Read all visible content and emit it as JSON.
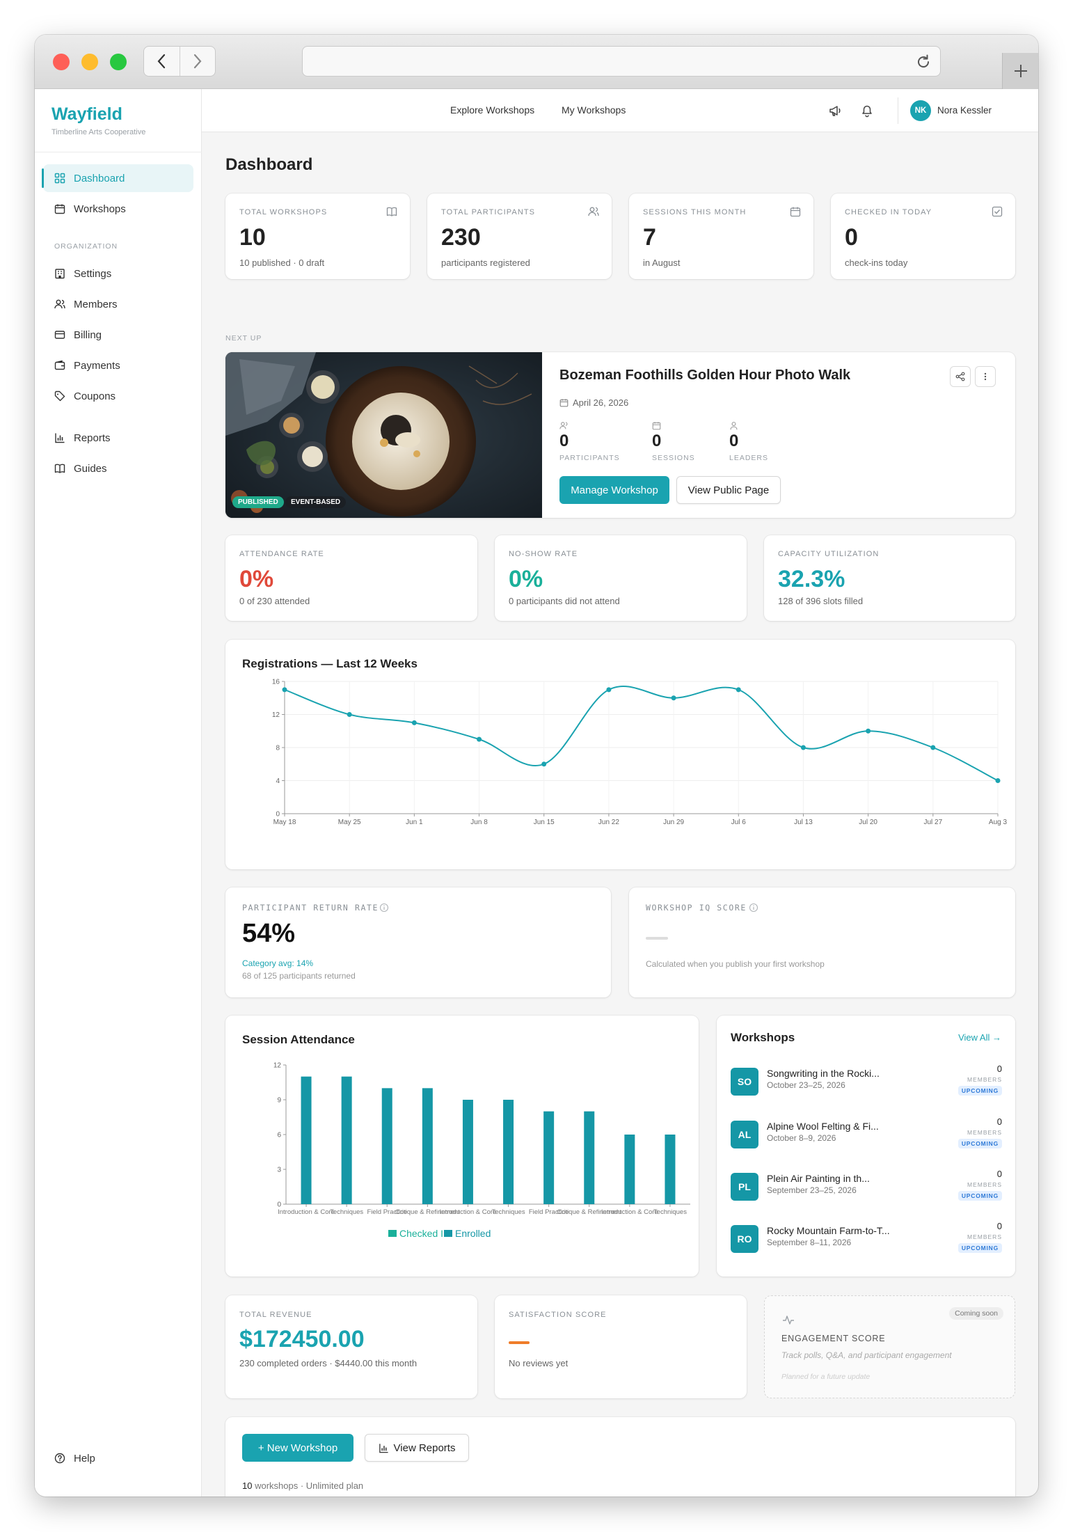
{
  "brand": {
    "name": "Wayfield",
    "org": "Timberline Arts Cooperative"
  },
  "sidebar": {
    "items": [
      {
        "label": "Dashboard",
        "icon": "grid-icon"
      },
      {
        "label": "Workshops",
        "icon": "calendar-icon"
      }
    ],
    "section_label": "ORGANIZATION",
    "org_items": [
      {
        "label": "Settings",
        "icon": "building-icon"
      },
      {
        "label": "Members",
        "icon": "users-icon"
      },
      {
        "label": "Billing",
        "icon": "card-icon"
      },
      {
        "label": "Payments",
        "icon": "wallet-icon"
      },
      {
        "label": "Coupons",
        "icon": "tag-icon"
      },
      {
        "label": "Reports",
        "icon": "bar-chart-icon"
      },
      {
        "label": "Guides",
        "icon": "book-icon"
      }
    ],
    "help": "Help"
  },
  "topbar": {
    "links": [
      "Explore Workshops",
      "My Workshops"
    ],
    "user": {
      "initials": "NK",
      "name": "Nora Kessler"
    }
  },
  "page_title": "Dashboard",
  "stats": [
    {
      "label": "TOTAL WORKSHOPS",
      "value": "10",
      "sub": "10 published · 0 draft",
      "icon": "book-icon"
    },
    {
      "label": "TOTAL PARTICIPANTS",
      "value": "230",
      "sub": "participants registered",
      "icon": "users-icon"
    },
    {
      "label": "SESSIONS THIS MONTH",
      "value": "7",
      "sub": "in August",
      "icon": "calendar-icon"
    },
    {
      "label": "CHECKED IN TODAY",
      "value": "0",
      "sub": "check-ins today",
      "icon": "check-square-icon"
    }
  ],
  "next_up": {
    "section_label": "NEXT UP",
    "title": "Bozeman Foothills Golden Hour Photo Walk",
    "date": "April 26, 2026",
    "badges": [
      "PUBLISHED",
      "EVENT-BASED"
    ],
    "metrics": [
      {
        "value": "0",
        "label": "PARTICIPANTS"
      },
      {
        "value": "0",
        "label": "SESSIONS"
      },
      {
        "value": "0",
        "label": "LEADERS"
      }
    ],
    "manage_label": "Manage Workshop",
    "public_label": "View Public Page"
  },
  "rates": [
    {
      "label": "ATTENDANCE RATE",
      "value": "0%",
      "sub": "0 of 230 attended",
      "color": "#e0493a"
    },
    {
      "label": "NO-SHOW RATE",
      "value": "0%",
      "sub": "0 participants did not attend",
      "color": "#1ab09a"
    },
    {
      "label": "CAPACITY UTILIZATION",
      "value": "32.3%",
      "sub": "128 of 396 slots filled",
      "color": "#1aa3b0"
    }
  ],
  "return_rate": {
    "label": "PARTICIPANT RETURN RATE",
    "value": "54%",
    "category": "Category avg: 14%",
    "sub": "68 of 125 participants returned"
  },
  "iq_score": {
    "label": "WORKSHOP IQ SCORE",
    "sub": "Calculated when you publish your first workshop"
  },
  "chart_data": [
    {
      "type": "line",
      "title": "Registrations — Last 12 Weeks",
      "categories": [
        "May 18",
        "May 25",
        "Jun 1",
        "Jun 8",
        "Jun 15",
        "Jun 22",
        "Jun 29",
        "Jul 6",
        "Jul 13",
        "Jul 20",
        "Jul 27",
        "Aug 3"
      ],
      "values": [
        15,
        12,
        11,
        9,
        6,
        15,
        14,
        15,
        8,
        10,
        8,
        4
      ],
      "ylim": [
        0,
        16
      ],
      "yticks": [
        0,
        4,
        8,
        12,
        16
      ],
      "color": "#1aa3b0"
    },
    {
      "type": "bar",
      "title": "Session Attendance",
      "categories": [
        "Introduction & Core Techniques",
        "Field Practice",
        "Critique & Refinement",
        "Introduction & Core Techniques",
        "Field Practice",
        "Critique & Refinement",
        "Introduction & Core Techniques",
        "Field Practice",
        "Critique & Refinement",
        "Introduction & Core Techniques"
      ],
      "tick_labels": [
        "Introduction & Core",
        "Techniques",
        "Field Practice",
        "Critique & Refinement",
        "Introduction & Core",
        "Techniques",
        "Field Practice",
        "Critique & Refinement",
        "Introduction & Core",
        "Techniques"
      ],
      "series": [
        {
          "name": "Checked In",
          "values": [
            0,
            0,
            0,
            0,
            0,
            0,
            0,
            0,
            0,
            0
          ],
          "color": "#1ab09a"
        },
        {
          "name": "Enrolled",
          "values": [
            11,
            11,
            10,
            10,
            9,
            9,
            8,
            8,
            6,
            6
          ],
          "color": "#1597a6"
        }
      ],
      "ylim": [
        0,
        12
      ],
      "yticks": [
        0,
        3,
        6,
        9,
        12
      ]
    }
  ],
  "workshops": {
    "title": "Workshops",
    "view_all": "View All →",
    "items": [
      {
        "initials": "SO",
        "title": "Songwriting in the Rocki...",
        "date": "October 23–25, 2026",
        "members": "0",
        "members_label": "MEMBERS",
        "status": "UPCOMING"
      },
      {
        "initials": "AL",
        "title": "Alpine Wool Felting & Fi...",
        "date": "October 8–9, 2026",
        "members": "0",
        "members_label": "MEMBERS",
        "status": "UPCOMING"
      },
      {
        "initials": "PL",
        "title": "Plein Air Painting in th...",
        "date": "September 23–25, 2026",
        "members": "0",
        "members_label": "MEMBERS",
        "status": "UPCOMING"
      },
      {
        "initials": "RO",
        "title": "Rocky Mountain Farm-to-T...",
        "date": "September 8–11, 2026",
        "members": "0",
        "members_label": "MEMBERS",
        "status": "UPCOMING"
      }
    ]
  },
  "revenue": {
    "label": "TOTAL REVENUE",
    "value": "$172450.00",
    "sub": "230 completed orders · $4440.00 this month"
  },
  "satisfaction": {
    "label": "SATISFACTION SCORE",
    "sub": "No reviews yet"
  },
  "engagement": {
    "badge": "Coming soon",
    "label": "ENGAGEMENT SCORE",
    "sub": "Track polls, Q&A, and participant engagement",
    "note": "Planned for a future update"
  },
  "actions": {
    "new_label": "+ New Workshop",
    "reports_label": "View Reports",
    "plan_count": "10",
    "plan_text": "workshops · Unlimited plan"
  },
  "colors": {
    "accent": "#1aa3b0",
    "danger": "#e0493a",
    "success": "#1ab09a",
    "warning": "#ef7d2a"
  }
}
